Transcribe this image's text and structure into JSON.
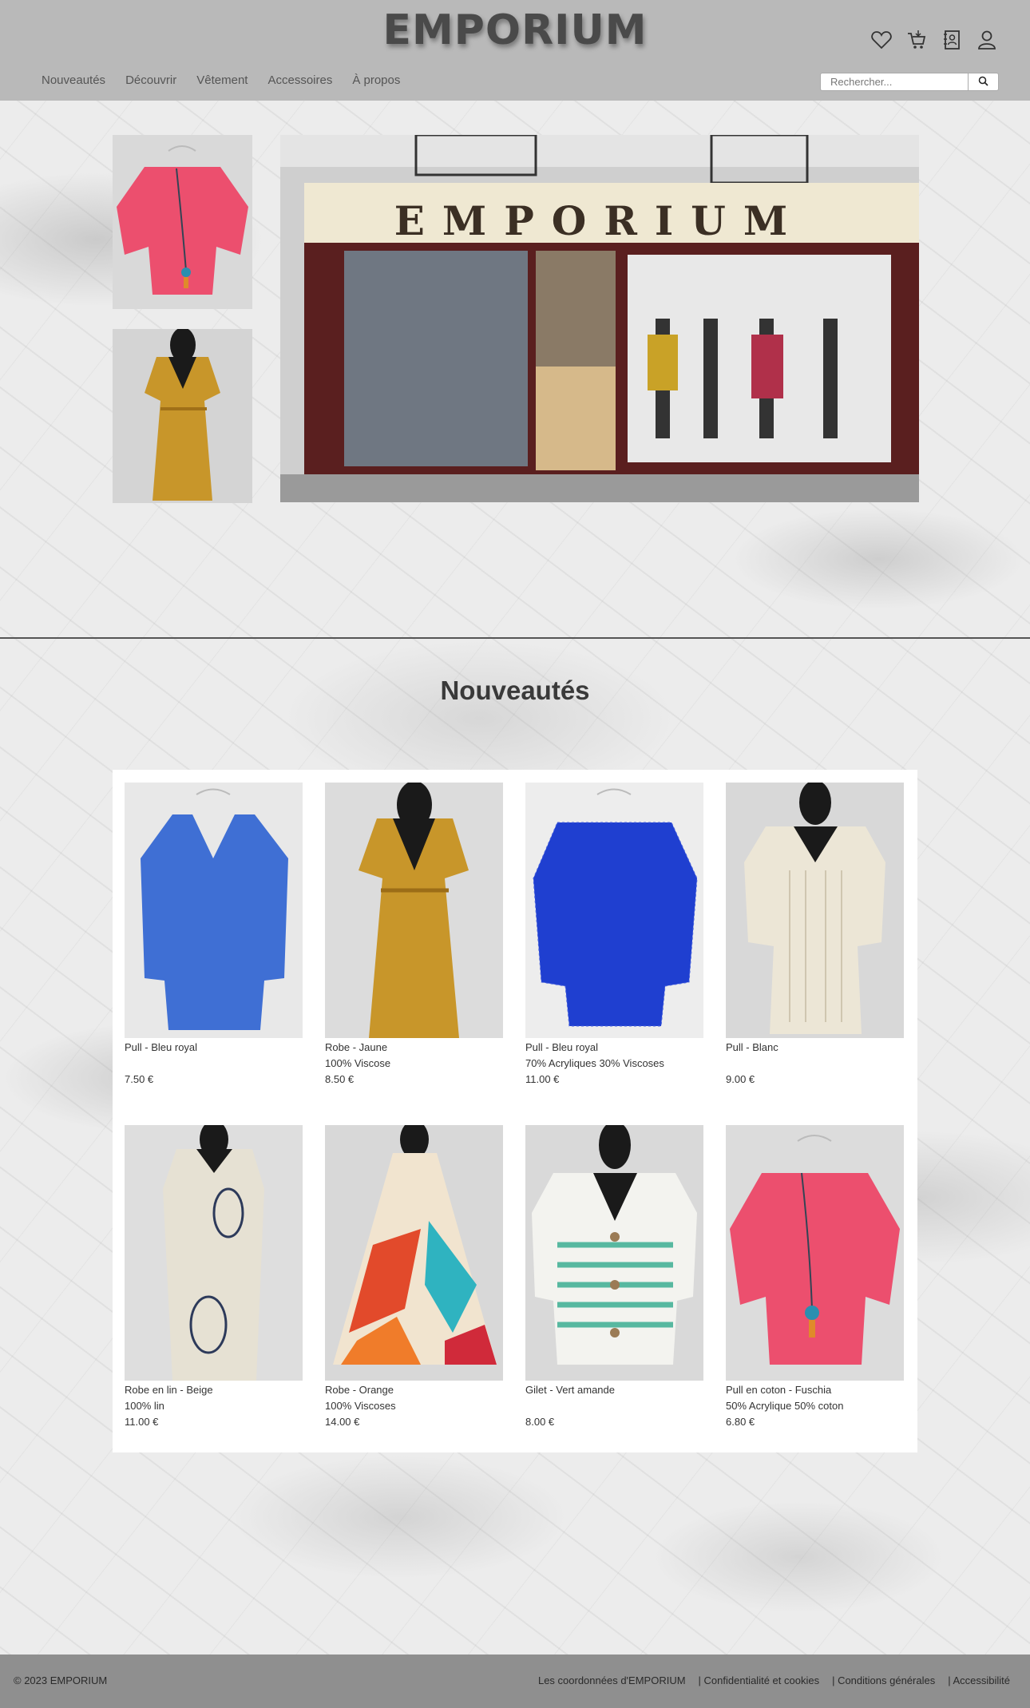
{
  "header": {
    "brand": "EMPORIUM",
    "icons": [
      "heart-icon",
      "cart-icon",
      "contact-book-icon",
      "user-icon"
    ],
    "nav": [
      "Nouveautés",
      "Découvrir",
      "Vêtement",
      "Accessoires",
      "À propos"
    ],
    "search": {
      "placeholder": "Rechercher...",
      "button_icon": "search-icon"
    }
  },
  "hero": {
    "store_sign": "EMPORIUM"
  },
  "section": {
    "title": "Nouveautés"
  },
  "products": [
    {
      "name": "Pull - Bleu royal",
      "detail": "",
      "price": "7.50 €"
    },
    {
      "name": "Robe - Jaune",
      "detail": "100% Viscose",
      "price": "8.50 €"
    },
    {
      "name": "Pull - Bleu royal",
      "detail": "70% Acryliques 30% Viscoses",
      "price": "11.00 €"
    },
    {
      "name": "Pull - Blanc",
      "detail": "",
      "price": "9.00 €"
    },
    {
      "name": "Robe en lin - Beige",
      "detail": "100% lin",
      "price": "11.00 €"
    },
    {
      "name": "Robe - Orange",
      "detail": "100% Viscoses",
      "price": "14.00 €"
    },
    {
      "name": "Gilet - Vert amande",
      "detail": "",
      "price": "8.00 €"
    },
    {
      "name": "Pull en coton - Fuschia",
      "detail": "50% Acrylique 50% coton",
      "price": "6.80 €"
    }
  ],
  "footer": {
    "copyright": "© 2023 EMPORIUM",
    "links": [
      "Les coordonnées d'EMPORIUM",
      "| Confidentialité et cookies",
      "| Conditions générales",
      "| Accessibilité"
    ]
  },
  "colors": {
    "header_bg": "#b9b9b9",
    "footer_bg": "#8f8f8f",
    "brand_text": "#4a4a4a"
  }
}
